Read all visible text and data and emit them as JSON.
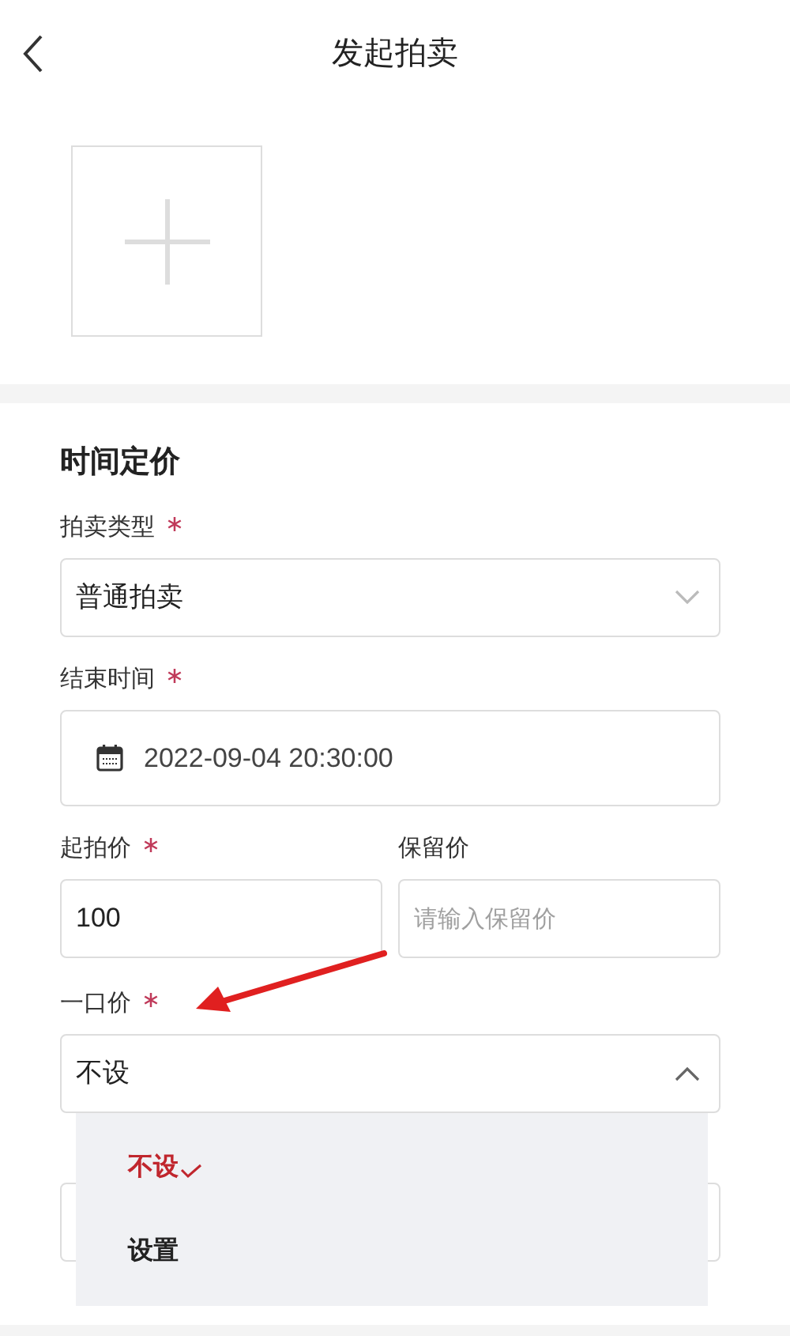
{
  "header": {
    "title": "发起拍卖"
  },
  "section": {
    "title": "时间定价"
  },
  "fields": [
    {
      "kind": "select",
      "label": "拍卖类型",
      "required": true,
      "value": "普通拍卖",
      "expanded": false
    },
    {
      "kind": "date",
      "label": "结束时间",
      "required": true,
      "value": "2022-09-04 20:30:00"
    },
    {
      "kind": "pair",
      "items": [
        {
          "label": "起拍价",
          "required": true,
          "value": "100"
        },
        {
          "label": "保留价",
          "required": false,
          "placeholder": "请输入保留价"
        }
      ]
    },
    {
      "kind": "select",
      "label": "一口价",
      "required": true,
      "value": "不设",
      "expanded": true,
      "options": [
        {
          "label": "不设",
          "selected": true
        },
        {
          "label": "设置",
          "selected": false
        }
      ]
    },
    {
      "kind": "hidden"
    }
  ]
}
